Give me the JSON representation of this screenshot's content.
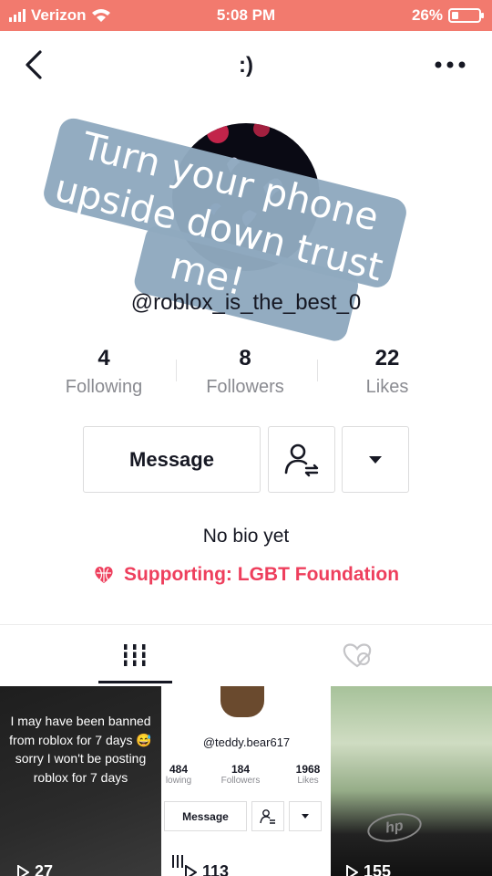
{
  "status_bar": {
    "carrier": "Verizon",
    "time": "5:08 PM",
    "battery_text": "26%",
    "battery_level": 0.26
  },
  "nav": {
    "title": ":)"
  },
  "overlay": {
    "line1": "Turn your phone",
    "line2": "upside down trust",
    "line3": "me!"
  },
  "profile": {
    "username": "@roblox_is_the_best_0",
    "stats": [
      {
        "count": "4",
        "label": "Following"
      },
      {
        "count": "8",
        "label": "Followers"
      },
      {
        "count": "22",
        "label": "Likes"
      }
    ],
    "message_label": "Message",
    "bio": "No bio yet",
    "supporting": "Supporting: LGBT Foundation"
  },
  "colors": {
    "status_bar": "#f27a6e",
    "supporting": "#ee3f5d",
    "overlay": "#8fa9bf"
  },
  "videos": [
    {
      "caption": "I may have been banned from roblox for 7 days 😅 sorry I won't be posting roblox for 7 days",
      "views": "27"
    },
    {
      "views": "113",
      "mini_username": "@teddy.bear617",
      "mini_stats": [
        {
          "count": "484",
          "label": "lowing"
        },
        {
          "count": "184",
          "label": "Followers"
        },
        {
          "count": "1968",
          "label": "Likes"
        }
      ],
      "mini_message": "Message"
    },
    {
      "views": "155",
      "brand": "hp"
    }
  ]
}
